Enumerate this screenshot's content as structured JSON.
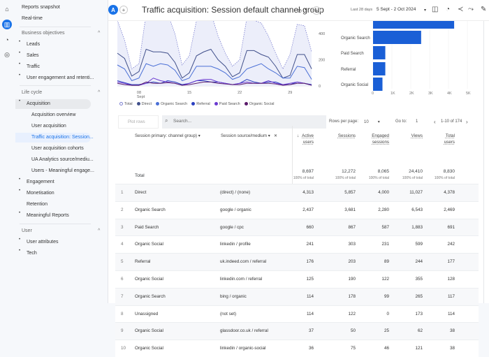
{
  "rail": {
    "icons": [
      "home-icon",
      "reports-icon",
      "explore-icon",
      "advertising-icon"
    ]
  },
  "sidebar": {
    "top": [
      "Reports snapshot",
      "Real-time"
    ],
    "business_objectives": {
      "label": "Business objectives",
      "items": [
        "Leads",
        "Sales",
        "Traffic",
        "User engagement and retenti..."
      ]
    },
    "life_cycle": {
      "label": "Life cycle",
      "acquisition": "Acquisition",
      "acquisition_items": [
        "Acquisition overview",
        "User acquisition",
        "Traffic acquisition: Session...",
        "User acquisition cohorts",
        "UA Analytics source/mediu...",
        "Users - Meaningful engage..."
      ],
      "items": [
        "Engagement",
        "Monetisation",
        "Retention",
        "Meaningful Reports"
      ]
    },
    "user": {
      "label": "User",
      "items": [
        "User attributes",
        "Tech"
      ]
    }
  },
  "header": {
    "property_badge": "A",
    "title": "Traffic acquisition: Session default channel group",
    "date_label": "Last 28 days",
    "date_range": "5 Sept - 2 Oct 2024"
  },
  "colors": {
    "accent": "#1a73e8",
    "bar": "#1a5fd6",
    "total": "#7b7fd0",
    "direct": "#41508b",
    "organic_search": "#4a6fd6",
    "referral": "#2a3fc0",
    "paid_search": "#6a3ad0",
    "organic_social": "#5a1a6a"
  },
  "chart_data": [
    {
      "type": "line",
      "x_ticks": [
        "08\nSept",
        "15",
        "22",
        "29"
      ],
      "y_ticks": [
        "0",
        "200",
        "400"
      ],
      "ylim": [
        0,
        496
      ],
      "x": [
        "5 Sept",
        "6",
        "7",
        "8",
        "9",
        "10",
        "11",
        "12",
        "13",
        "14",
        "15",
        "16",
        "17",
        "18",
        "19",
        "20",
        "21",
        "22",
        "23",
        "24",
        "25",
        "26",
        "27",
        "28",
        "29",
        "30",
        "1 Oct",
        "2 Oct"
      ],
      "series": [
        {
          "name": "Total",
          "style": "dotted-area",
          "values": [
            500,
            350,
            130,
            170,
            550,
            520,
            560,
            550,
            400,
            160,
            230,
            500,
            560,
            560,
            380,
            250,
            150,
            200,
            520,
            500,
            480,
            380,
            250,
            130,
            240,
            470,
            460,
            260
          ]
        },
        {
          "name": "Direct",
          "values": [
            250,
            210,
            75,
            110,
            280,
            260,
            260,
            250,
            180,
            60,
            100,
            230,
            260,
            280,
            200,
            150,
            70,
            100,
            270,
            270,
            240,
            220,
            150,
            60,
            80,
            240,
            240,
            130
          ]
        },
        {
          "name": "Organic Search",
          "values": [
            160,
            130,
            40,
            60,
            170,
            150,
            170,
            160,
            120,
            40,
            60,
            150,
            150,
            150,
            130,
            100,
            50,
            70,
            130,
            150,
            170,
            130,
            100,
            60,
            60,
            150,
            140,
            50
          ]
        },
        {
          "name": "Referral",
          "values": [
            40,
            25,
            10,
            10,
            20,
            30,
            20,
            40,
            30,
            10,
            20,
            40,
            40,
            30,
            30,
            20,
            10,
            20,
            50,
            30,
            20,
            30,
            30,
            10,
            10,
            30,
            20,
            10
          ]
        },
        {
          "name": "Paid Search",
          "values": [
            30,
            20,
            5,
            5,
            20,
            60,
            40,
            30,
            20,
            5,
            20,
            40,
            50,
            50,
            30,
            20,
            10,
            20,
            30,
            20,
            20,
            40,
            20,
            10,
            20,
            30,
            20,
            5
          ]
        },
        {
          "name": "Organic Social",
          "values": [
            20,
            10,
            5,
            5,
            30,
            20,
            20,
            25,
            20,
            5,
            10,
            20,
            30,
            30,
            20,
            15,
            10,
            10,
            20,
            20,
            20,
            20,
            15,
            5,
            10,
            20,
            20,
            5
          ]
        }
      ]
    },
    {
      "type": "bar",
      "orientation": "horizontal",
      "categories": [
        "Direct",
        "Organic Search",
        "Paid Search",
        "Referral",
        "Organic Social"
      ],
      "values": [
        4300,
        2550,
        650,
        650,
        500
      ],
      "x_ticks": [
        "0",
        "1K",
        "2K",
        "3K",
        "4K",
        "5K"
      ],
      "xlim": [
        0,
        5000
      ]
    }
  ],
  "table": {
    "plot_rows": "Plot rows",
    "search_placeholder": "Search...",
    "rows_per_page_label": "Rows per page:",
    "rows_per_page": "10",
    "goto_label": "Go to:",
    "goto": "1",
    "pagination": "1-10 of 174",
    "dim1": "Session primary: channel group)",
    "dim2": "Session source/medium",
    "columns": [
      [
        "Active",
        "users"
      ],
      [
        "Sessions",
        ""
      ],
      [
        "Engaged",
        "sessions"
      ],
      [
        "Views",
        ""
      ],
      [
        "Total",
        "users"
      ]
    ],
    "total_label": "Total",
    "totals": [
      "8,697",
      "12,272",
      "8,065",
      "24,410",
      "8,830"
    ],
    "pct": "100% of total",
    "rows": [
      [
        "1",
        "Direct",
        "(direct) / (none)",
        "4,313",
        "5,857",
        "4,000",
        "11,027",
        "4,378"
      ],
      [
        "2",
        "Organic Search",
        "google / organic",
        "2,437",
        "3,681",
        "2,280",
        "6,543",
        "2,469"
      ],
      [
        "3",
        "Paid Search",
        "google / cpc",
        "660",
        "867",
        "587",
        "1,883",
        "691"
      ],
      [
        "4",
        "Organic Social",
        "linkedin / profile",
        "241",
        "303",
        "231",
        "599",
        "242"
      ],
      [
        "5",
        "Referral",
        "uk.indeed.com / referral",
        "176",
        "203",
        "89",
        "244",
        "177"
      ],
      [
        "6",
        "Organic Social",
        "linkedin.com / referral",
        "125",
        "190",
        "122",
        "355",
        "128"
      ],
      [
        "7",
        "Organic Search",
        "bing / organic",
        "114",
        "178",
        "99",
        "265",
        "117"
      ],
      [
        "8",
        "Unassigned",
        "(not set)",
        "114",
        "122",
        "0",
        "173",
        "114"
      ],
      [
        "9",
        "Organic Social",
        "glassdoor.co.uk / referral",
        "37",
        "50",
        "25",
        "62",
        "38"
      ],
      [
        "10",
        "Organic Social",
        "linkedin / organic-social",
        "36",
        "75",
        "46",
        "121",
        "38"
      ]
    ]
  }
}
